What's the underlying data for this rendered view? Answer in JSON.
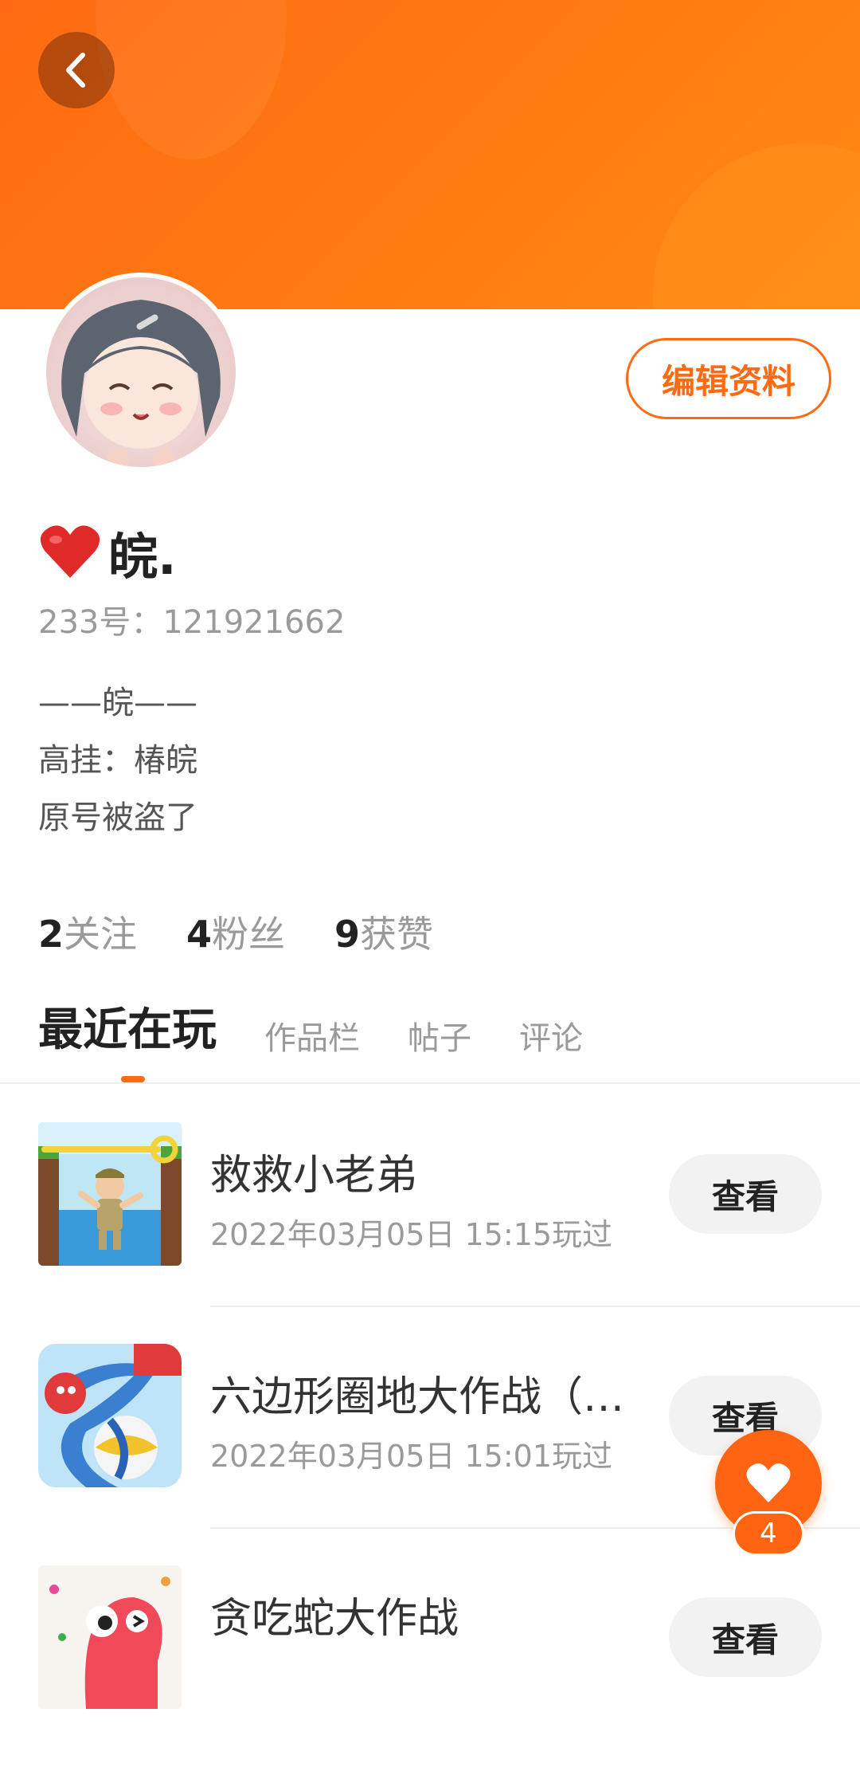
{
  "header": {
    "back_icon": "chevron-left-icon",
    "color": "#ff6a12"
  },
  "profile": {
    "name_emoji": "❤️",
    "name": "皖.",
    "uid_text": "233号：121921662",
    "bio": [
      "——皖——",
      "高挂：椿皖",
      "原号被盗了"
    ],
    "edit_label": "编辑资料"
  },
  "stats": [
    {
      "num": "2",
      "label": "关注"
    },
    {
      "num": "4",
      "label": "粉丝"
    },
    {
      "num": "9",
      "label": "获赞"
    }
  ],
  "tabs": [
    {
      "label": "最近在玩",
      "active": true
    },
    {
      "label": "作品栏"
    },
    {
      "label": "帖子"
    },
    {
      "label": "评论"
    }
  ],
  "games": [
    {
      "title": "救救小老弟",
      "time": "2022年03月05日 15:15玩过",
      "button": "查看"
    },
    {
      "title": "六边形圈地大作战（…",
      "time": "2022年03月05日 15:01玩过",
      "button": "查看"
    },
    {
      "title": "贪吃蛇大作战",
      "time": "",
      "button": "查看"
    }
  ],
  "fab": {
    "icon": "heart-icon",
    "count": "4"
  },
  "colors": {
    "accent": "#ff6a12",
    "text": "#222222",
    "muted": "#9a9a9a"
  }
}
